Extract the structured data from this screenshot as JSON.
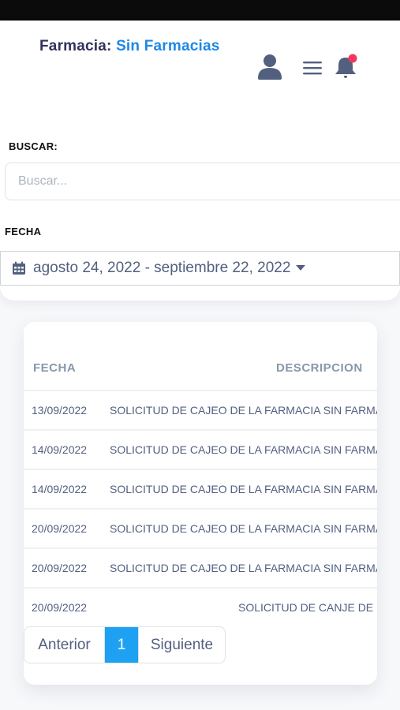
{
  "header": {
    "farmacia_label": "Farmacia:",
    "farmacia_value": "Sin Farmacias",
    "icons": [
      "user-icon",
      "menu-icon",
      "bell-icon"
    ],
    "notification_dot_color": "#f5365c"
  },
  "filters": {
    "search_label": "BUSCAR:",
    "search_placeholder": "Buscar...",
    "search_value": "",
    "date_label": "FECHA",
    "date_range": "agosto 24, 2022 - septiembre 22, 2022"
  },
  "table": {
    "columns": [
      "FECHA",
      "DESCRIPCION"
    ],
    "rows": [
      {
        "fecha": "13/09/2022",
        "descripcion": "SOLICITUD DE CAJEO DE LA FARMACIA SIN FARMACIA"
      },
      {
        "fecha": "14/09/2022",
        "descripcion": "SOLICITUD DE CAJEO DE LA FARMACIA SIN FARMACIA"
      },
      {
        "fecha": "14/09/2022",
        "descripcion": "SOLICITUD DE CAJEO DE LA FARMACIA SIN FARMACIA"
      },
      {
        "fecha": "20/09/2022",
        "descripcion": "SOLICITUD DE CAJEO DE LA FARMACIA SIN FARMACIA"
      },
      {
        "fecha": "20/09/2022",
        "descripcion": "SOLICITUD DE CAJEO DE LA FARMACIA SIN FARMACIA"
      },
      {
        "fecha": "20/09/2022",
        "descripcion": "SOLICITUD DE CANJE DE FARMACIA"
      }
    ]
  },
  "pagination": {
    "prev_label": "Anterior",
    "current_page": "1",
    "next_label": "Siguiente"
  },
  "colors": {
    "accent": "#1ea1f2",
    "link": "#1e88e5",
    "icon": "#525f7f"
  }
}
